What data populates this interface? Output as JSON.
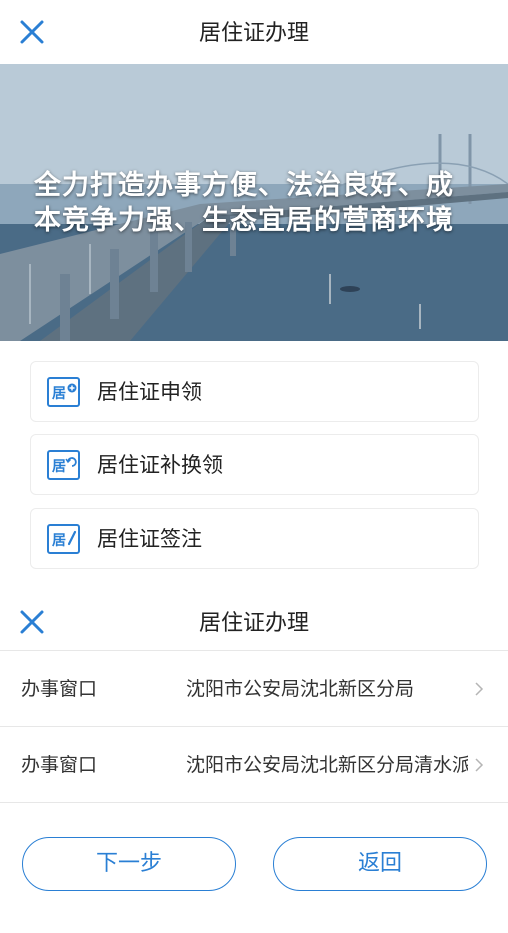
{
  "header": {
    "title": "居住证办理"
  },
  "banner": {
    "slogan_line1": "全力打造办事方便、法治良好、成",
    "slogan_line2": "本竞争力强、生态宜居的营商环境"
  },
  "menu": {
    "items": [
      {
        "label": "居住证申领",
        "icon": "residence-apply-icon"
      },
      {
        "label": "居住证补换领",
        "icon": "residence-reissue-icon"
      },
      {
        "label": "居住证签注",
        "icon": "residence-endorse-icon"
      }
    ]
  },
  "sheet": {
    "title": "居住证办理",
    "rows": [
      {
        "label": "办事窗口",
        "value": "沈阳市公安局沈北新区分局"
      },
      {
        "label": "办事窗口",
        "value": "沈阳市公安局沈北新区分局清水派"
      }
    ]
  },
  "actions": {
    "next_label": "下一步",
    "back_label": "返回"
  },
  "colors": {
    "accent": "#2a7fd4",
    "text": "#222222",
    "divider": "#e7e7e7"
  }
}
